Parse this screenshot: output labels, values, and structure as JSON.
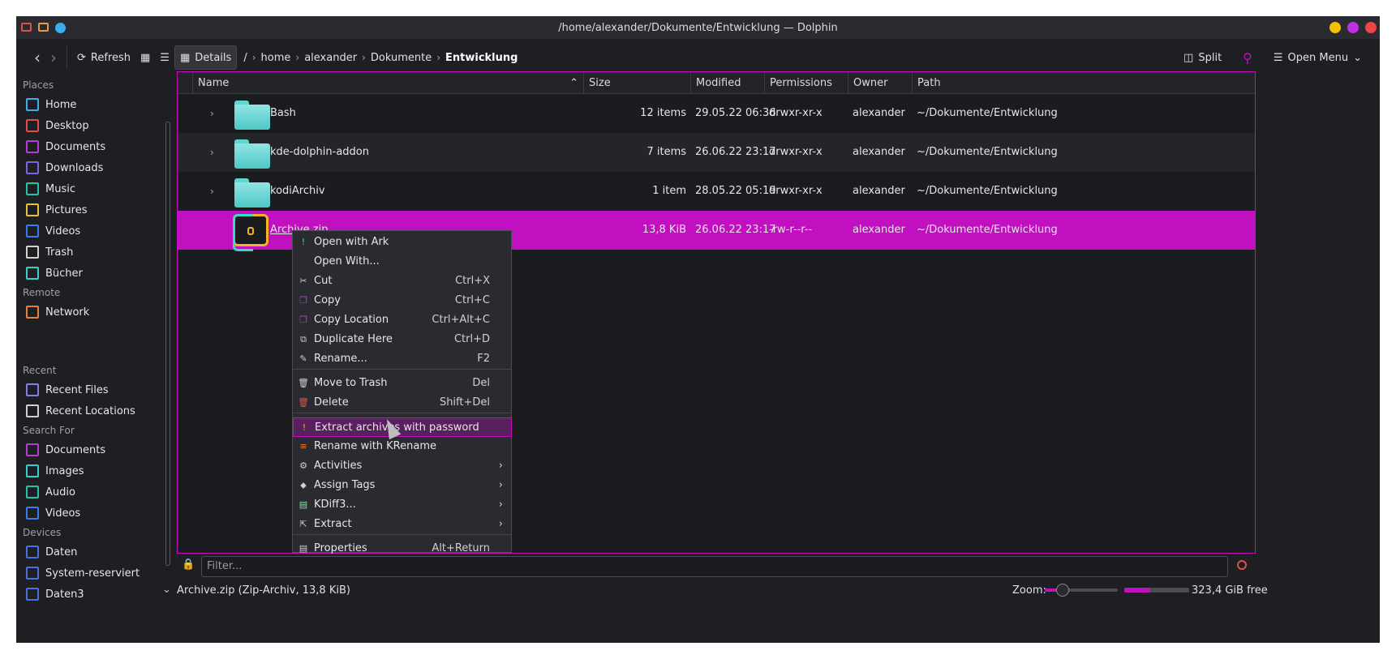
{
  "window": {
    "title": "/home/alexander/Dokumente/Entwicklung — Dolphin",
    "controls_colors": [
      "#f5c000",
      "#c02fe0",
      "#ef4545"
    ]
  },
  "toolbar": {
    "refresh": "Refresh",
    "details": "Details",
    "breadcrumb_root": "/",
    "breadcrumbs": [
      "home",
      "alexander",
      "Dokumente",
      "Entwicklung"
    ],
    "split": "Split",
    "open_menu": "Open Menu"
  },
  "sidebar": {
    "places_title": "Places",
    "places": [
      {
        "label": "Home",
        "icon": "home-icon",
        "color": "#3daee9"
      },
      {
        "label": "Desktop",
        "icon": "desktop-icon",
        "color": "#e14d4d"
      },
      {
        "label": "Documents",
        "icon": "documents-icon",
        "color": "#b33bd6"
      },
      {
        "label": "Downloads",
        "icon": "downloads-icon",
        "color": "#7b62e8"
      },
      {
        "label": "Music",
        "icon": "music-icon",
        "color": "#27c0a8"
      },
      {
        "label": "Pictures",
        "icon": "pictures-icon",
        "color": "#e8c13a"
      },
      {
        "label": "Videos",
        "icon": "videos-icon",
        "color": "#3d7ae9"
      },
      {
        "label": "Trash",
        "icon": "trash-icon",
        "color": "#cfcfcf"
      },
      {
        "label": "Bücher",
        "icon": "folder-icon",
        "color": "#36cfc9"
      }
    ],
    "remote_title": "Remote",
    "remote": [
      {
        "label": "Network",
        "icon": "network-icon",
        "color": "#e8813a"
      }
    ],
    "recent_title": "Recent",
    "recent": [
      {
        "label": "Recent Files",
        "icon": "recent-files-icon",
        "color": "#8a7ce8"
      },
      {
        "label": "Recent Locations",
        "icon": "recent-locations-icon",
        "color": "#cfcfcf"
      }
    ],
    "search_title": "Search For",
    "search": [
      {
        "label": "Documents",
        "icon": "documents-search-icon",
        "color": "#b33bd6"
      },
      {
        "label": "Images",
        "icon": "images-icon",
        "color": "#36cfc9"
      },
      {
        "label": "Audio",
        "icon": "audio-icon",
        "color": "#27c0a8"
      },
      {
        "label": "Videos",
        "icon": "videos-search-icon",
        "color": "#3d7ae9"
      }
    ],
    "devices_title": "Devices",
    "devices": [
      {
        "label": "Daten",
        "icon": "drive-icon",
        "color": "#4a6ee0"
      },
      {
        "label": "System-reserviert",
        "icon": "drive-icon",
        "color": "#4a6ee0"
      },
      {
        "label": "Daten3",
        "icon": "drive-icon",
        "color": "#4a6ee0"
      }
    ]
  },
  "columns": [
    "Name",
    "Size",
    "Modified",
    "Permissions",
    "Owner",
    "Path"
  ],
  "files": [
    {
      "name": "Bash",
      "size": "12 items",
      "modified": "29.05.22 06:36",
      "permissions": "drwxr-xr-x",
      "owner": "alexander",
      "path": "~/Dokumente/Entwicklung"
    },
    {
      "name": "kde-dolphin-addon",
      "size": "7 items",
      "modified": "26.06.22 23:17",
      "permissions": "drwxr-xr-x",
      "owner": "alexander",
      "path": "~/Dokumente/Entwicklung"
    },
    {
      "name": "kodiArchiv",
      "size": "1 item",
      "modified": "28.05.22 05:19",
      "permissions": "drwxr-xr-x",
      "owner": "alexander",
      "path": "~/Dokumente/Entwicklung"
    },
    {
      "name": "Archive.zip",
      "size": "13,8 KiB",
      "modified": "26.06.22 23:17",
      "permissions": "-rw-r--r--",
      "owner": "alexander",
      "path": "~/Dokumente/Entwicklung"
    }
  ],
  "context_menu": [
    {
      "label": "Open with Ark",
      "shortcut": "",
      "icon": "ark-icon"
    },
    {
      "label": "Open With...",
      "shortcut": "",
      "icon": ""
    },
    {
      "label": "Cut",
      "shortcut": "Ctrl+X",
      "icon": "cut-icon"
    },
    {
      "label": "Copy",
      "shortcut": "Ctrl+C",
      "icon": "copy-icon"
    },
    {
      "label": "Copy Location",
      "shortcut": "Ctrl+Alt+C",
      "icon": "copy-location-icon"
    },
    {
      "label": "Duplicate Here",
      "shortcut": "Ctrl+D",
      "icon": "duplicate-icon"
    },
    {
      "label": "Rename...",
      "shortcut": "F2",
      "icon": "rename-icon"
    },
    {
      "label": "Move to Trash",
      "shortcut": "Del",
      "icon": "trash-icon"
    },
    {
      "label": "Delete",
      "shortcut": "Shift+Del",
      "icon": "delete-icon"
    },
    {
      "label": "Extract archives with password",
      "shortcut": "",
      "icon": "extract-password-icon"
    },
    {
      "label": "Rename with KRename",
      "shortcut": "",
      "icon": "krename-icon"
    },
    {
      "label": "Activities",
      "shortcut": "",
      "icon": "activities-icon"
    },
    {
      "label": "Assign Tags",
      "shortcut": "",
      "icon": "tag-icon"
    },
    {
      "label": "KDiff3...",
      "shortcut": "",
      "icon": "kdiff3-icon"
    },
    {
      "label": "Extract",
      "shortcut": "",
      "icon": "extract-icon"
    },
    {
      "label": "Properties",
      "shortcut": "Alt+Return",
      "icon": "properties-icon"
    }
  ],
  "filter": {
    "placeholder": "Filter..."
  },
  "status": {
    "selection": "Archive.zip (Zip-Archiv, 13,8 KiB)",
    "zoom_label": "Zoom:",
    "free_space": "323,4 GiB free",
    "disk_used_fraction": 0.4
  }
}
